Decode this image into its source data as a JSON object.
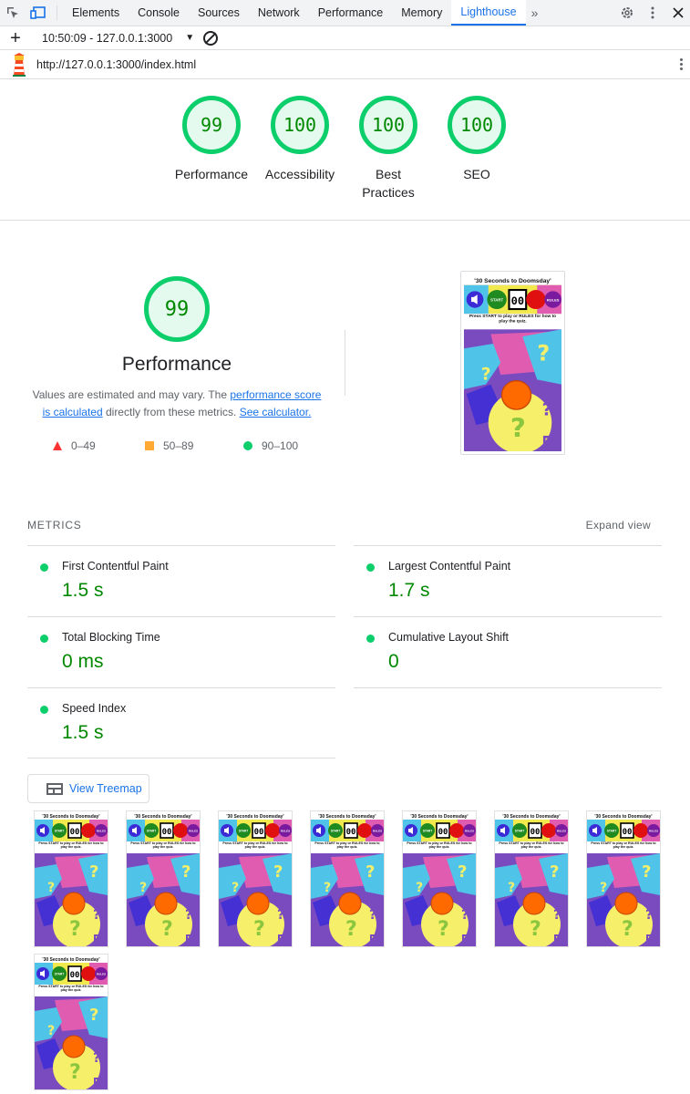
{
  "devtools": {
    "tabs": [
      {
        "label": "Elements"
      },
      {
        "label": "Console"
      },
      {
        "label": "Sources"
      },
      {
        "label": "Network"
      },
      {
        "label": "Performance"
      },
      {
        "label": "Memory"
      },
      {
        "label": "Lighthouse",
        "active": true
      }
    ],
    "more_tabs": "»"
  },
  "toolbar": {
    "report_label": "10:50:09 - 127.0.0.1:3000"
  },
  "urlbar": {
    "url": "http://127.0.0.1:3000/index.html"
  },
  "categories": [
    {
      "score": "99",
      "label": "Performance"
    },
    {
      "score": "100",
      "label": "Accessibility"
    },
    {
      "score": "100",
      "label": "Best Practices"
    },
    {
      "score": "100",
      "label": "SEO"
    }
  ],
  "performance": {
    "score": "99",
    "title": "Performance",
    "desc_prefix": "Values are estimated and may vary. The ",
    "link_score": "performance score is calculated",
    "desc_middle": " directly from these metrics. ",
    "link_calc": "See calculator.",
    "legend": [
      {
        "range": "0–49",
        "shape": "triangle",
        "color": "#ff3333"
      },
      {
        "range": "50–89",
        "shape": "square",
        "color": "#ffaa33"
      },
      {
        "range": "90–100",
        "shape": "circle",
        "color": "#0cce6b"
      }
    ]
  },
  "metrics": {
    "heading": "METRICS",
    "expand_label": "Expand view",
    "items": [
      {
        "name": "First Contentful Paint",
        "value": "1.5 s"
      },
      {
        "name": "Largest Contentful Paint",
        "value": "1.7 s"
      },
      {
        "name": "Total Blocking Time",
        "value": "0 ms"
      },
      {
        "name": "Cumulative Layout Shift",
        "value": "0"
      },
      {
        "name": "Speed Index",
        "value": "1.5 s"
      }
    ]
  },
  "treemap_label": "View Treemap",
  "screenshot": {
    "title": "'30 Seconds to Doomsday'",
    "start": "START",
    "rules": "RULES",
    "timer": "00",
    "instructions": "Press START to play or RULES for how to play the quiz.",
    "question_mark": "?"
  },
  "filmstrip_count": 8,
  "colors": {
    "pass_green": "#0cce6b",
    "score_text": "#008800",
    "link_blue": "#1a73e8"
  }
}
